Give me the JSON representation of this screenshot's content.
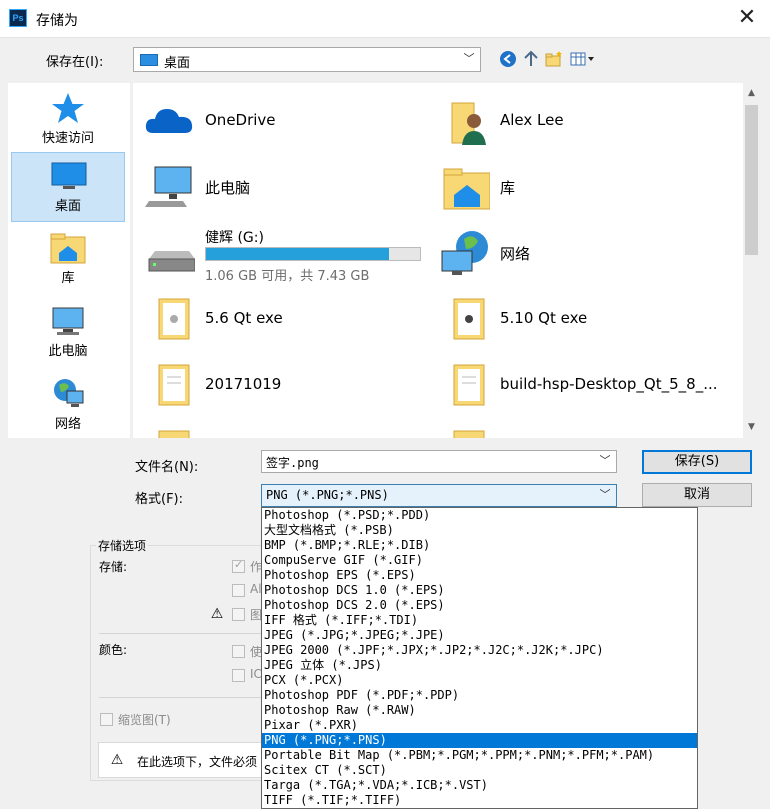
{
  "window": {
    "title": "存储为",
    "close_glyph": "✕"
  },
  "location": {
    "label": "保存在(I):",
    "value": "桌面"
  },
  "places": [
    {
      "label": "快速访问",
      "icon": "star-icon"
    },
    {
      "label": "桌面",
      "icon": "desktop-icon",
      "selected": true
    },
    {
      "label": "库",
      "icon": "library-icon"
    },
    {
      "label": "此电脑",
      "icon": "computer-icon"
    },
    {
      "label": "网络",
      "icon": "network-icon"
    }
  ],
  "files": {
    "onedrive": "OneDrive",
    "user": "Alex Lee",
    "this_pc": "此电脑",
    "library": "库",
    "drive": {
      "name": "健辉 (G:)",
      "space": "1.06 GB 可用，共 7.43 GB",
      "used_fraction": 0.857
    },
    "network": "网络",
    "f1": "5.6 Qt exe",
    "f2": "5.10 Qt exe",
    "f3": "20171019",
    "f4": "build-hsp-Desktop_Qt_5_8_..."
  },
  "filename": {
    "label": "文件名(N):",
    "value": "签字.png"
  },
  "format": {
    "label": "格式(F):",
    "value": "PNG (*.PNG;*.PNS)"
  },
  "buttons": {
    "save": "保存(S)",
    "cancel": "取消"
  },
  "options": {
    "group_title": "存储选项",
    "storage_label": "存储:",
    "cb1": "作",
    "cb2": "Al",
    "cb3": "图",
    "color_label": "颜色:",
    "cb4": "使",
    "cb5": "IC",
    "thumbnail": "缩览图(T)",
    "warning": "在此选项下，文件必须"
  },
  "format_options": [
    "Photoshop (*.PSD;*.PDD)",
    "大型文档格式 (*.PSB)",
    "BMP (*.BMP;*.RLE;*.DIB)",
    "CompuServe GIF (*.GIF)",
    "Photoshop EPS (*.EPS)",
    "Photoshop DCS 1.0 (*.EPS)",
    "Photoshop DCS 2.0 (*.EPS)",
    "IFF 格式 (*.IFF;*.TDI)",
    "JPEG (*.JPG;*.JPEG;*.JPE)",
    "JPEG 2000 (*.JPF;*.JPX;*.JP2;*.J2C;*.J2K;*.JPC)",
    "JPEG 立体 (*.JPS)",
    "PCX (*.PCX)",
    "Photoshop PDF (*.PDF;*.PDP)",
    "Photoshop Raw (*.RAW)",
    "Pixar (*.PXR)",
    "PNG (*.PNG;*.PNS)",
    "Portable Bit Map (*.PBM;*.PGM;*.PPM;*.PNM;*.PFM;*.PAM)",
    "Scitex CT (*.SCT)",
    "Targa (*.TGA;*.VDA;*.ICB;*.VST)",
    "TIFF (*.TIF;*.TIFF)"
  ],
  "selected_format_index": 15,
  "colors": {
    "accent": "#0078d7",
    "folder": "#f8d775"
  }
}
